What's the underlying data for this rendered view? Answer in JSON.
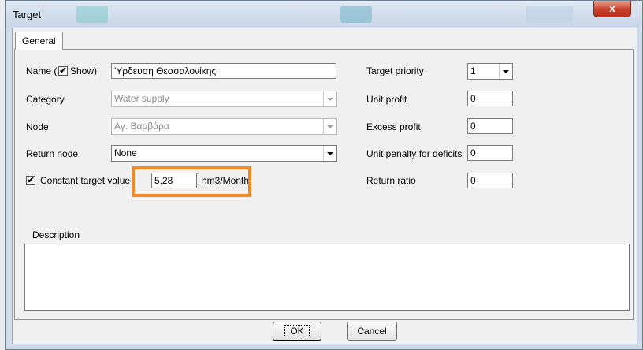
{
  "window": {
    "title": "Target",
    "close_label": "x"
  },
  "tabs": [
    {
      "label": "General"
    }
  ],
  "form": {
    "name_prefix": "Name (",
    "show_label": "Show)",
    "show_checked": "✔",
    "name_value": "'Υρδευση Θεσσαλονίκης",
    "category_label": "Category",
    "category_value": "Water supply",
    "node_label": "Node",
    "node_value": "Αγ. Βαρβάρα",
    "return_node_label": "Return node",
    "return_node_value": "None",
    "constant_target_label": "Constant target value",
    "constant_target_checked": "✔",
    "constant_target_value": "5,28",
    "constant_target_unit": "hm3/Month",
    "target_priority_label": "Target priority",
    "target_priority_value": "1",
    "unit_profit_label": "Unit profit",
    "unit_profit_value": "0",
    "excess_profit_label": "Excess profit",
    "excess_profit_value": "0",
    "unit_penalty_label": "Unit penalty for deficits",
    "unit_penalty_value": "0",
    "return_ratio_label": "Return ratio",
    "return_ratio_value": "0",
    "description_label": "Description",
    "description_value": ""
  },
  "buttons": {
    "ok": "OK",
    "cancel": "Cancel"
  },
  "colors": {
    "highlight": "#f08a24",
    "close_button": "#c8412a"
  }
}
